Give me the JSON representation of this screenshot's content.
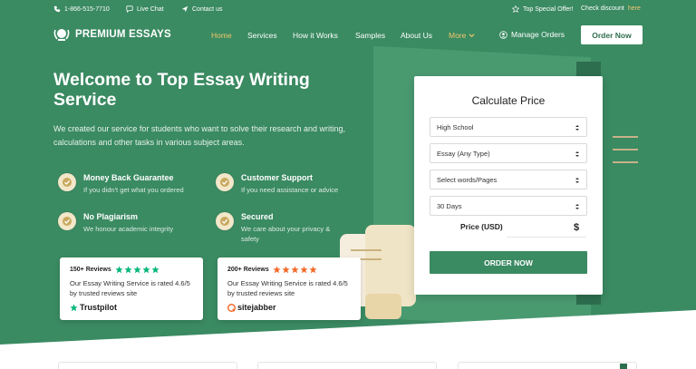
{
  "topbar": {
    "phone": "1-866-515-7710",
    "live_chat": "Live Chat",
    "contact": "Contact us",
    "special_offer": "Top Special Offer!",
    "check_discount": "Check discount",
    "here": "here"
  },
  "brand": {
    "name": "PREMIUM ESSAYS"
  },
  "nav": {
    "items": [
      "Home",
      "Services",
      "How it Works",
      "Samples",
      "About Us",
      "More"
    ],
    "manage_orders": "Manage Orders",
    "order_now": "Order Now"
  },
  "hero": {
    "title": "Welcome to Top Essay Writing Service",
    "lead": "We created our service for students who want to solve their research and writing, calculations and other tasks in various subject areas."
  },
  "features": [
    {
      "title": "Money Back Guarantee",
      "subtitle": "If you didn't get what you ordered"
    },
    {
      "title": "Customer Support",
      "subtitle": "If you need assistance or advice"
    },
    {
      "title": "No Plagiarism",
      "subtitle": "We honour academic integrity"
    },
    {
      "title": "Secured",
      "subtitle": "We care about your privacy & safety"
    }
  ],
  "reviews": [
    {
      "count": "150+ Reviews",
      "text": "Our Essay Writing Service is rated 4.6/5 by trusted reviews site",
      "brand": "Trustpilot",
      "star_color": "#00b67a"
    },
    {
      "count": "200+ Reviews",
      "text": "Our Essay Writing Service is rated 4.6/5 by trusted reviews site",
      "brand": "sitejabber",
      "star_color": "#f26b2a"
    }
  ],
  "calculator": {
    "title": "Calculate Price",
    "level": "High School",
    "type": "Essay (Any Type)",
    "pages_placeholder": "Select words/Pages",
    "deadline": "30 Days",
    "price_label": "Price (USD)",
    "price_value": "$",
    "order_button": "ORDER NOW"
  },
  "colors": {
    "primary": "#3a8a62",
    "accent": "#f2c76b"
  }
}
